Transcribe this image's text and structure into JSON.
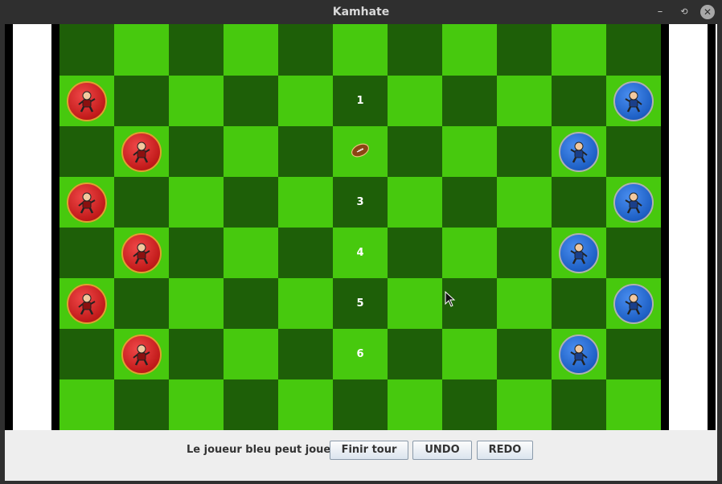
{
  "window": {
    "title": "Kamhate",
    "minimize_glyph": "–",
    "maximize_glyph": "⟲",
    "close_glyph": "✕"
  },
  "board": {
    "columns": 11,
    "rows": 8,
    "row_numbers": [
      {
        "row": 1,
        "label": "1"
      },
      {
        "row": 3,
        "label": "3"
      },
      {
        "row": 4,
        "label": "4"
      },
      {
        "row": 5,
        "label": "5"
      },
      {
        "row": 6,
        "label": "6"
      }
    ],
    "red_pieces": [
      {
        "row": 1,
        "col": 0
      },
      {
        "row": 2,
        "col": 1
      },
      {
        "row": 3,
        "col": 0
      },
      {
        "row": 4,
        "col": 1
      },
      {
        "row": 5,
        "col": 0
      },
      {
        "row": 6,
        "col": 1
      }
    ],
    "blue_pieces": [
      {
        "row": 1,
        "col": 10
      },
      {
        "row": 2,
        "col": 9
      },
      {
        "row": 3,
        "col": 10
      },
      {
        "row": 4,
        "col": 9
      },
      {
        "row": 5,
        "col": 10
      },
      {
        "row": 6,
        "col": 9
      }
    ],
    "ball": {
      "row": 2,
      "col": 5
    },
    "colors": {
      "dark": "#1e5f08",
      "light": "#47c90e",
      "red_team": "#d42323",
      "blue_team": "#2a6fd6"
    }
  },
  "status": {
    "text": "Le joueur bleu peut jouer",
    "finir_label": "Finir tour",
    "undo_label": "UNDO",
    "redo_label": "REDO"
  }
}
